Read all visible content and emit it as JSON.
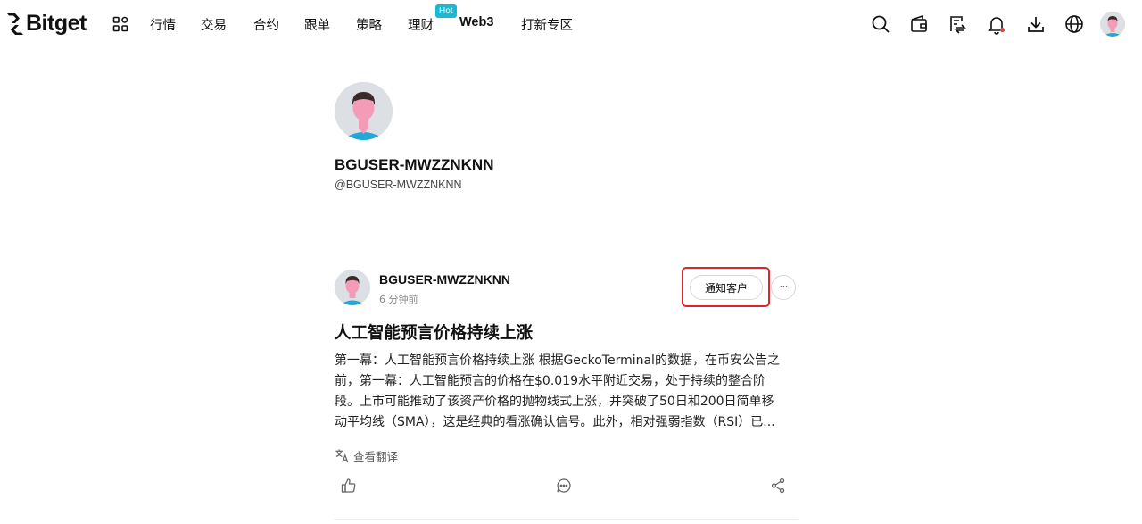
{
  "brand": {
    "name": "Bitget"
  },
  "nav": {
    "items": [
      {
        "id": "market",
        "label": "行情"
      },
      {
        "id": "trade",
        "label": "交易"
      },
      {
        "id": "futures",
        "label": "合约"
      },
      {
        "id": "copy",
        "label": "跟单"
      },
      {
        "id": "strategy",
        "label": "策略"
      },
      {
        "id": "earn",
        "label": "理财"
      },
      {
        "id": "web3",
        "label": "Web3"
      },
      {
        "id": "launch",
        "label": "打新专区"
      }
    ],
    "hot_badge": "Hot"
  },
  "header_icons": [
    "search-icon",
    "wallet-icon",
    "orders-icon",
    "bell-icon",
    "download-icon",
    "globe-icon"
  ],
  "profile": {
    "name": "BGUSER-MWZZNKNN",
    "handle": "@BGUSER-MWZZNKNN"
  },
  "post": {
    "author": "BGUSER-MWZZNKNN",
    "time": "6 分钟前",
    "notify_label": "通知客户",
    "more_label": "···",
    "title": "人工智能预言价格持续上涨",
    "body_lines": [
      "第一幕：人工智能预言价格持续上涨 根据GeckoTerminal的数据，在币安公告之",
      "前，第一幕：人工智能预言的价格在$0.019水平附近交易，处于持续的整合阶",
      "段。上市可能推动了该资产价格的抛物线式上涨，并突破了50日和200日简单移",
      "动平均线（SMA），这是经典的看涨确认信号。此外，相对强弱指数（RSI）已..."
    ],
    "translate_label": "查看翻译"
  },
  "colors": {
    "accent_highlight": "#d9262e",
    "hot_badge": "#19b8d3",
    "avatar_skin": "#f49bb7",
    "avatar_shirt": "#20a8d8"
  }
}
